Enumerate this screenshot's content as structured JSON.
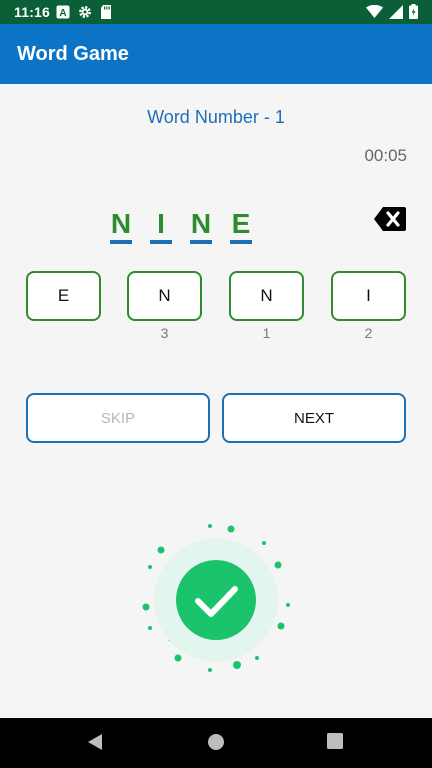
{
  "status_bar": {
    "time": "11:16",
    "icons_left": [
      "text-format-icon",
      "settings-icon",
      "sd-card-icon"
    ],
    "icons_right": [
      "wifi-icon",
      "signal-icon",
      "battery-icon"
    ]
  },
  "app_bar": {
    "title": "Word Game"
  },
  "game": {
    "word_number_label": "Word Number - 1",
    "timer": "00:05",
    "answer_letters": [
      "N",
      "I",
      "N",
      "E"
    ],
    "tiles": [
      {
        "letter": "E",
        "index": ""
      },
      {
        "letter": "N",
        "index": "3"
      },
      {
        "letter": "N",
        "index": "1"
      },
      {
        "letter": "I",
        "index": "2"
      }
    ]
  },
  "buttons": {
    "skip_label": "SKIP",
    "next_label": "NEXT"
  },
  "result": {
    "icon": "success-check-icon"
  },
  "colors": {
    "status_bar": "#0b5f36",
    "app_bar": "#0b74c7",
    "accent_blue": "#1f6fb5",
    "tile_green": "#2e8b2e",
    "success_green": "#1cc36d"
  },
  "nav_bar": {
    "icons": [
      "back-icon",
      "home-icon",
      "recents-icon"
    ]
  }
}
